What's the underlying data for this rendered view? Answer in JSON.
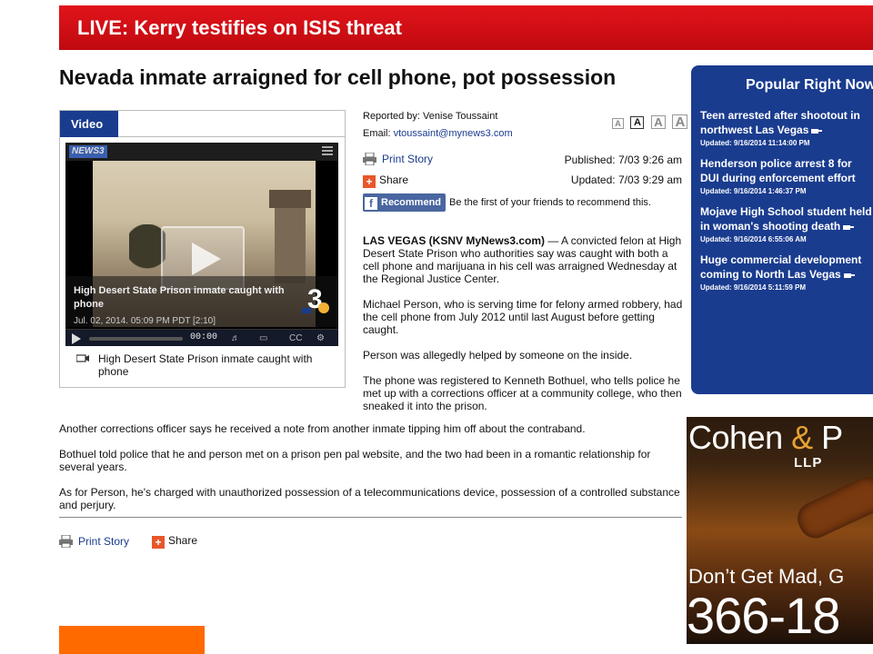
{
  "banner": {
    "text": "LIVE: Kerry testifies on ISIS threat",
    "color": "#d9121a"
  },
  "article": {
    "headline": "Nevada inmate arraigned for cell phone, pot possession",
    "reported_by": "Reported by: Venise Toussaint",
    "email_label": "Email:",
    "email": "vtoussaint@mynews3.com",
    "text_size_buttons": [
      "A",
      "A",
      "A",
      "A"
    ],
    "print_story": "Print Story",
    "share": "Share",
    "published": "Published: 7/03 9:26 am",
    "updated": "Updated: 7/03 9:29 am",
    "recommend_button": "Recommend",
    "recommend_text": "Be the first of your friends to recommend this.",
    "dateline": "LAS VEGAS (KSNV MyNews3.com)",
    "paragraph_1_rest": " — A convicted felon at High Desert State Prison who authorities say was caught with both a cell phone and marijuana in his cell was arraigned Wednesday at the Regional Justice Center.",
    "paragraph_2": "Michael Person, who is serving time for felony armed robbery, had the cell phone from July 2012 until last August before getting caught.",
    "paragraph_3": "Person was allegedly helped by someone on the inside.",
    "paragraph_4": "The phone was registered to Kenneth Bothuel, who tells police he met up with a corrections officer at a community college, who then sneaked it into the prison.",
    "paragraph_5": "Another corrections officer says he received a note from another inmate tipping him off about the contraband.",
    "paragraph_6": "Bothuel told police that he and person met on a prison pen pal website, and the two had been in a romantic relationship for several years.",
    "paragraph_7": "As for Person, he's charged with unauthorized possession of a telecommunications device, possession of a controlled substance and perjury.",
    "print_story_bottom": "Print Story",
    "share_bottom": "Share"
  },
  "video": {
    "tab_label": "Video",
    "logo_text": "NEWS3",
    "overlay_title": "High Desert State Prison inmate caught with phone",
    "overlay_date": "Jul. 02, 2014. 05:09 PM PDT [2:10]",
    "time": "00:00",
    "cc_label": "CC",
    "caption": "High Desert State Prison inmate caught with phone"
  },
  "popular": {
    "title": "Popular Right Now",
    "items": [
      {
        "title": "Teen arrested after shootout in northwest Las Vegas",
        "updated": "Updated: 9/16/2014 11:14:00 PM"
      },
      {
        "title": "Henderson police arrest 8 for DUI during enforcement effort",
        "updated": "Updated: 9/16/2014 1:46:37 PM"
      },
      {
        "title": "Mojave High School student held in woman's shooting death",
        "updated": "Updated: 9/16/2014 6:55:06 AM"
      },
      {
        "title": "Huge commercial development coming to North Las Vegas",
        "updated": "Updated: 9/16/2014 5:11:59 PM"
      }
    ],
    "color": "#1a3c8f"
  },
  "ad": {
    "name_1": "Cohen ",
    "name_amp": "&",
    "name_2": " P",
    "llp": "LLP",
    "tagline": "Don’t Get Mad, G",
    "phone": "366-18"
  }
}
